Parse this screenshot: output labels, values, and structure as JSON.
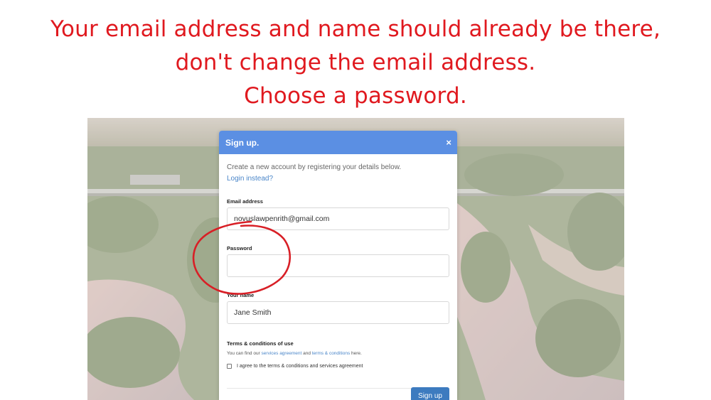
{
  "caption": {
    "line1": "Your email address and name should already be there,",
    "line2": "don't change the email address.",
    "line3": "Choose a password."
  },
  "modal": {
    "title": "Sign up.",
    "close_symbol": "×",
    "intro": "Create a new account by registering your details below.",
    "login_link": "Login instead?",
    "email_label": "Email address",
    "email_value": "novuslawpenrith@gmail.com",
    "password_label": "Password",
    "password_value": "",
    "name_label": "Your name",
    "name_value": "Jane Smith",
    "terms_heading": "Terms & conditions of use",
    "terms_prefix": "You can find our ",
    "terms_link1": "services agreement",
    "terms_mid": " and ",
    "terms_link2": "terms & conditions",
    "terms_suffix": " here.",
    "agree_label": "I agree to the terms & conditions and services agreement",
    "agree_checked": false,
    "signup_button": "Sign up"
  },
  "colors": {
    "caption": "#e0191f",
    "header": "#5b8fe3",
    "button": "#3d7bbf",
    "link": "#4a86c9",
    "annotation": "#d81f26"
  }
}
